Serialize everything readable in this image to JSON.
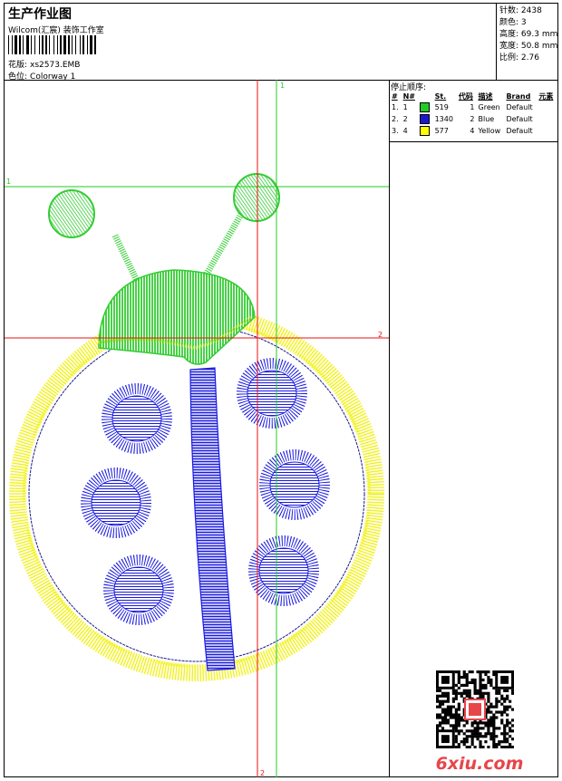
{
  "header": {
    "title": "生产作业图",
    "studio": "Wilcom(汇宸) 装饰工作室",
    "design_label": "花版:",
    "design_file": "xs2573.EMB",
    "colorway_label": "色位:",
    "colorway": "Colorway 1"
  },
  "stats": [
    {
      "label": "针数:",
      "value": "2438"
    },
    {
      "label": "颜色:",
      "value": "3"
    },
    {
      "label": "高度:",
      "value": "69.3 mm"
    },
    {
      "label": "宽度:",
      "value": "50.8 mm"
    },
    {
      "label": "比例:",
      "value": "2.76"
    }
  ],
  "stop_sequence": {
    "title": "停止顺序:",
    "columns": [
      "#",
      "N#",
      "St.",
      "代码",
      "描述",
      "Brand",
      "元素"
    ],
    "rows": [
      {
        "index": "1.",
        "needle": "1",
        "color": "#22cc22",
        "stitches": "519",
        "code": "1",
        "desc": "Green",
        "brand": "Default",
        "element": ""
      },
      {
        "index": "2.",
        "needle": "2",
        "color": "#1a1acc",
        "stitches": "1340",
        "code": "2",
        "desc": "Blue",
        "brand": "Default",
        "element": ""
      },
      {
        "index": "3.",
        "needle": "4",
        "color": "#ffff00",
        "stitches": "577",
        "code": "4",
        "desc": "Yellow",
        "brand": "Default",
        "element": ""
      }
    ]
  },
  "guides": {
    "green_v_label": "1",
    "green_h_label": "1",
    "red_h_label": "2",
    "red_v_label": "2"
  },
  "colors": {
    "green_thread": "#33cc33",
    "blue_thread": "#1a1adf",
    "yellow_thread": "#f2f21a",
    "guide_green": "#22cc22",
    "guide_red": "#ee1111",
    "watermark_red": "#e8454a"
  },
  "watermark": "6xiu.com"
}
